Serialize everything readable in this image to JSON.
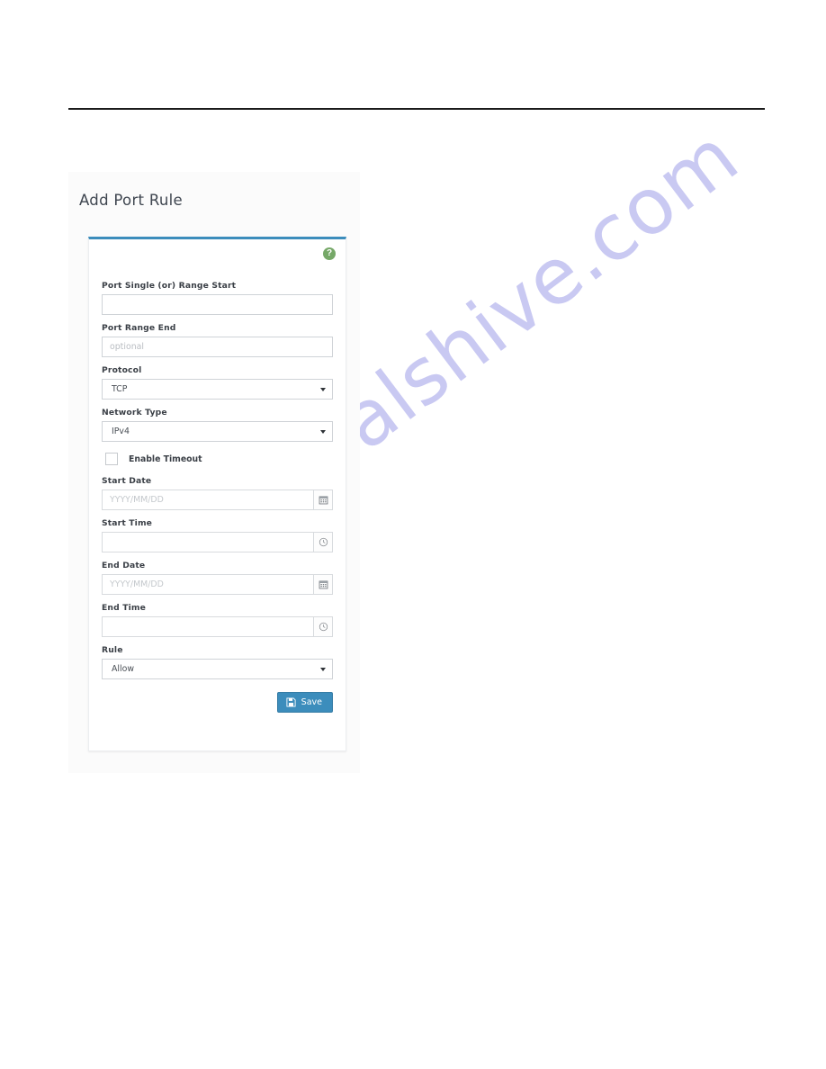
{
  "page": {
    "background": "#ffffff",
    "watermark_text": "manualshive.com",
    "watermark_color": "#c9c9f2",
    "rule_color": "#1b1b1b"
  },
  "panel": {
    "title": "Add Port Rule",
    "accent_color": "#3c8dbc",
    "help_icon_color": "#76a868",
    "help_icon_glyph": "?"
  },
  "form": {
    "fields": [
      {
        "id": "port-single-range-start",
        "label": "Port Single (or) Range Start",
        "kind": "text",
        "value": "",
        "placeholder": ""
      },
      {
        "id": "port-range-end",
        "label": "Port Range End",
        "kind": "text",
        "value": "",
        "placeholder": "optional"
      },
      {
        "id": "protocol",
        "label": "Protocol",
        "kind": "select",
        "value": "TCP"
      },
      {
        "id": "network-type",
        "label": "Network Type",
        "kind": "select",
        "value": "IPv4"
      },
      {
        "id": "start-date",
        "label": "Start Date",
        "kind": "date",
        "value": "",
        "placeholder": "YYYY/MM/DD",
        "addon_icon": "calendar-icon"
      },
      {
        "id": "start-time",
        "label": "Start Time",
        "kind": "time",
        "value": "",
        "placeholder": "",
        "addon_icon": "clock-icon"
      },
      {
        "id": "end-date",
        "label": "End Date",
        "kind": "date",
        "value": "",
        "placeholder": "YYYY/MM/DD",
        "addon_icon": "calendar-icon"
      },
      {
        "id": "end-time",
        "label": "End Time",
        "kind": "time",
        "value": "",
        "placeholder": "",
        "addon_icon": "clock-icon"
      },
      {
        "id": "rule",
        "label": "Rule",
        "kind": "select",
        "value": "Allow"
      }
    ],
    "enable_timeout": {
      "label": "Enable Timeout",
      "checked": false
    },
    "save_button": {
      "label": "Save",
      "icon": "save-floppy-icon",
      "background": "#3c8dbc"
    }
  }
}
